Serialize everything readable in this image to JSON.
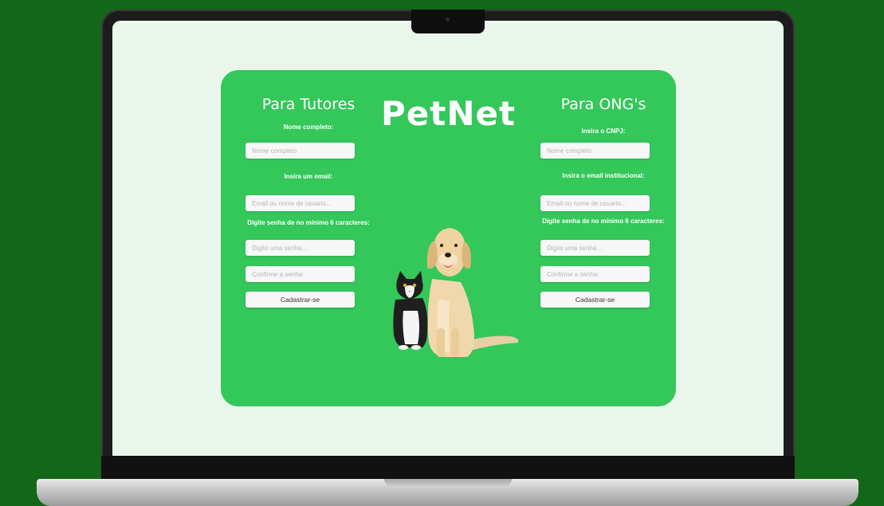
{
  "app": {
    "brand": "PetNet"
  },
  "tutores": {
    "title": "Para Tutores",
    "nome_label": "Nome completo:",
    "nome_placeholder": "Nome completo",
    "email_label": "Insira um email:",
    "email_placeholder": "Email ou nome de usuario...",
    "senha_label": "Digite senha de no mínimo 6 caracteres:",
    "senha_placeholder": "Digite uma senha...",
    "confirm_placeholder": "Confirme a senha:",
    "submit_label": "Cadastrar-se"
  },
  "ongs": {
    "title": "Para ONG's",
    "cnpj_label": "Insira o CNPJ:",
    "cnpj_placeholder": "Nome completo",
    "email_label": "Insira o email institucional:",
    "email_placeholder": "Email ou nome de usuario...",
    "senha_label": "Digite senha de no mínimo 6 caracteres:",
    "senha_placeholder": "Digite uma senha...",
    "confirm_placeholder": "Confirme a senha:",
    "submit_label": "Cadastrar-se"
  },
  "illustration": {
    "icons": [
      "cat-icon",
      "dog-icon"
    ]
  },
  "colors": {
    "background": "#146619",
    "card": "#34c75a",
    "screen": "#eaf5ec"
  }
}
